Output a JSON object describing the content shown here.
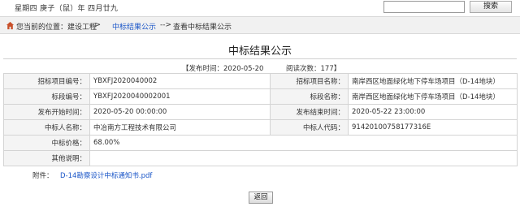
{
  "topbar": {
    "date": "星期四 庚子（鼠）年 四月廿九",
    "search_value": "",
    "search_label": "搜索"
  },
  "breadcrumb": {
    "prefix": "您当前的位置：建设工程",
    "sep1": "-->",
    "link": "中标结果公示",
    "sep2": "-->",
    "current": "查看中标结果公示"
  },
  "notice": {
    "title": "中标结果公示",
    "publish_time": "【发布时间：2020-05-20",
    "views": "阅读次数：177】"
  },
  "table": {
    "rows": [
      {
        "l1": "招标项目编号：",
        "v1": "YBXFJ2020040002",
        "l2": "招标项目名称：",
        "v2": "南岸西区地面绿化地下停车场项目（D-14地块）"
      },
      {
        "l1": "标段编号：",
        "v1": "YBXFJ2020040002001",
        "l2": "标段名称：",
        "v2": "南岸西区地面绿化地下停车场项目（D-14地块）"
      },
      {
        "l1": "发布开始时间：",
        "v1": "2020-05-20 00:00:00",
        "l2": "发布结束时间：",
        "v2": "2020-05-22 23:00:00"
      },
      {
        "l1": "中标人名称：",
        "v1": "中冶南方工程技术有限公司",
        "l2": "中标人代码：",
        "v2": "91420100758177316E"
      }
    ],
    "price_label": "中标价格：",
    "price_value": "68.00%",
    "remark_label": "其他说明：",
    "remark_value": ""
  },
  "attachment": {
    "label": "附件：",
    "file": "D-14勘察设计中标通知书.pdf"
  },
  "back_label": "返回"
}
